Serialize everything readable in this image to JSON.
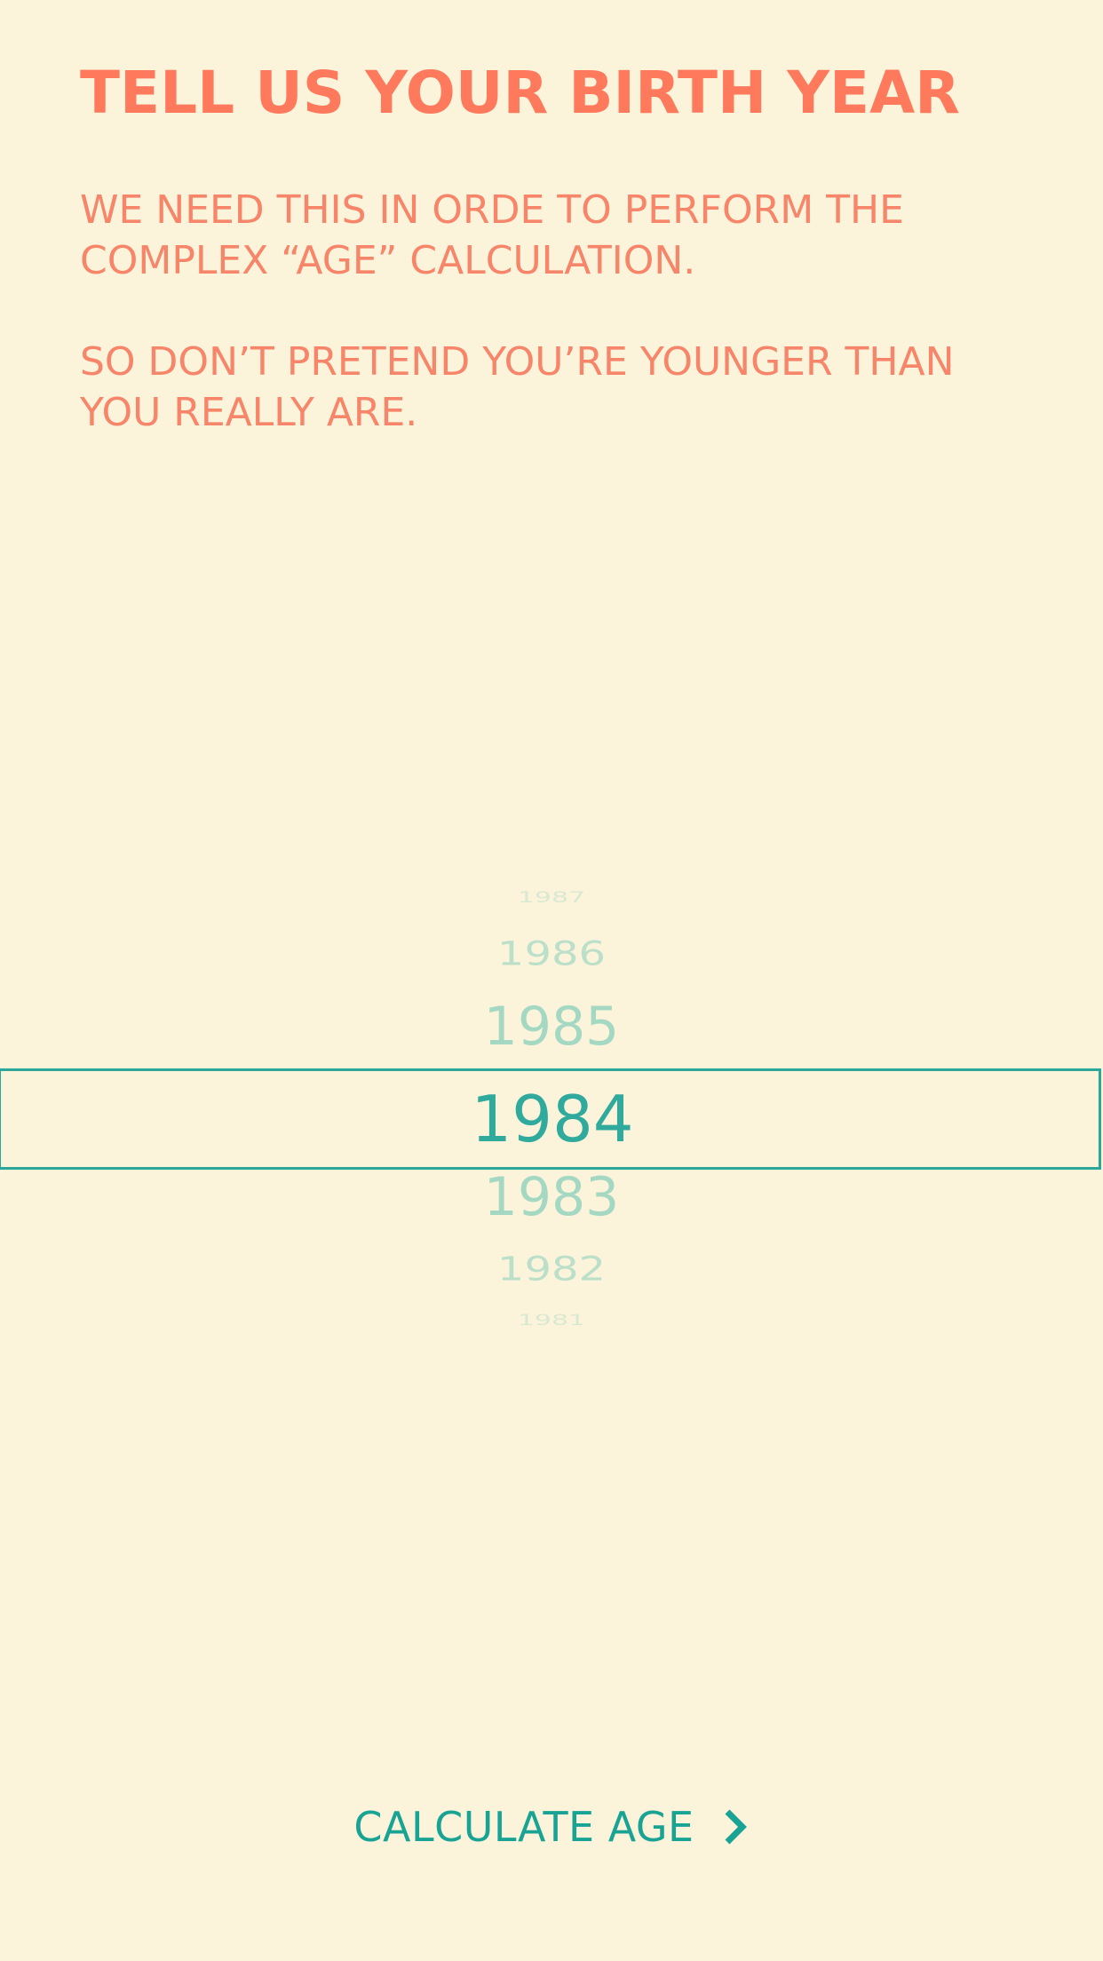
{
  "header": {
    "title": "TELL US YOUR BIRTH YEAR",
    "paragraph_1": "WE NEED THIS IN ORDE TO PERFORM THE COMPLEX “AGE” CALCULATION.",
    "paragraph_2": "SO DON’T PRETEND YOU’RE YOUNGER THAN YOU REALLY ARE."
  },
  "picker": {
    "years_above": [
      "1987",
      "1986",
      "1985"
    ],
    "selected_year": "1984",
    "years_below": [
      "1983",
      "1982",
      "1981"
    ]
  },
  "cta": {
    "label": "CALCULATE AGE",
    "icon": "chevron-right-icon"
  },
  "colors": {
    "background": "#fbf4db",
    "heading": "#ff7a5c",
    "body_text": "#f7856a",
    "accent": "#2aa79a"
  }
}
